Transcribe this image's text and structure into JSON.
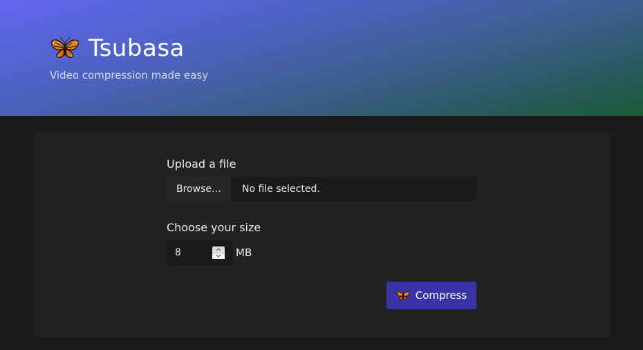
{
  "header": {
    "title": "Tsubasa",
    "tagline": "Video compression made easy",
    "logo_icon": "butterfly-icon"
  },
  "upload": {
    "label": "Upload a file",
    "browse_label": "Browse…",
    "status": "No file selected."
  },
  "size": {
    "label": "Choose your size",
    "value": "8",
    "unit": "MB"
  },
  "compress": {
    "label": "Compress",
    "icon": "butterfly-icon"
  },
  "colors": {
    "accent": "#3a33a7",
    "header_gradient_start": "#6466f0",
    "header_gradient_end": "#175b35",
    "background": "#1a1a1a",
    "card": "#222222"
  }
}
